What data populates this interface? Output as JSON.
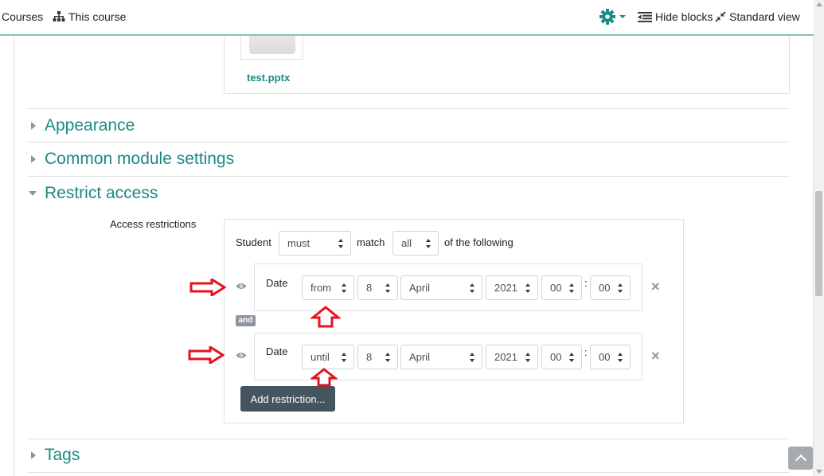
{
  "navbar": {
    "courses_label": "Courses",
    "this_course_label": "This course",
    "hide_blocks_label": "Hide blocks",
    "standard_view_label": "Standard view"
  },
  "file": {
    "name": "test.pptx"
  },
  "sections": {
    "appearance": "Appearance",
    "common_module": "Common module settings",
    "restrict_access": "Restrict access",
    "tags": "Tags"
  },
  "restrictions": {
    "label": "Access restrictions",
    "student_label": "Student",
    "must_value": "must",
    "match_label": "match",
    "all_value": "all",
    "of_following_label": "of the following",
    "and_label": "and",
    "conditions": [
      {
        "type_label": "Date",
        "direction": "from",
        "day": "8",
        "month": "April",
        "year": "2021",
        "hour": "00",
        "minute": "00"
      },
      {
        "type_label": "Date",
        "direction": "until",
        "day": "8",
        "month": "April",
        "year": "2021",
        "hour": "00",
        "minute": "00"
      }
    ],
    "time_separator": ":",
    "close_symbol": "×",
    "add_button_label": "Add restriction..."
  },
  "colors": {
    "accent": "#1a8a83",
    "annotation": "#e3141c",
    "button": "#44555f"
  }
}
